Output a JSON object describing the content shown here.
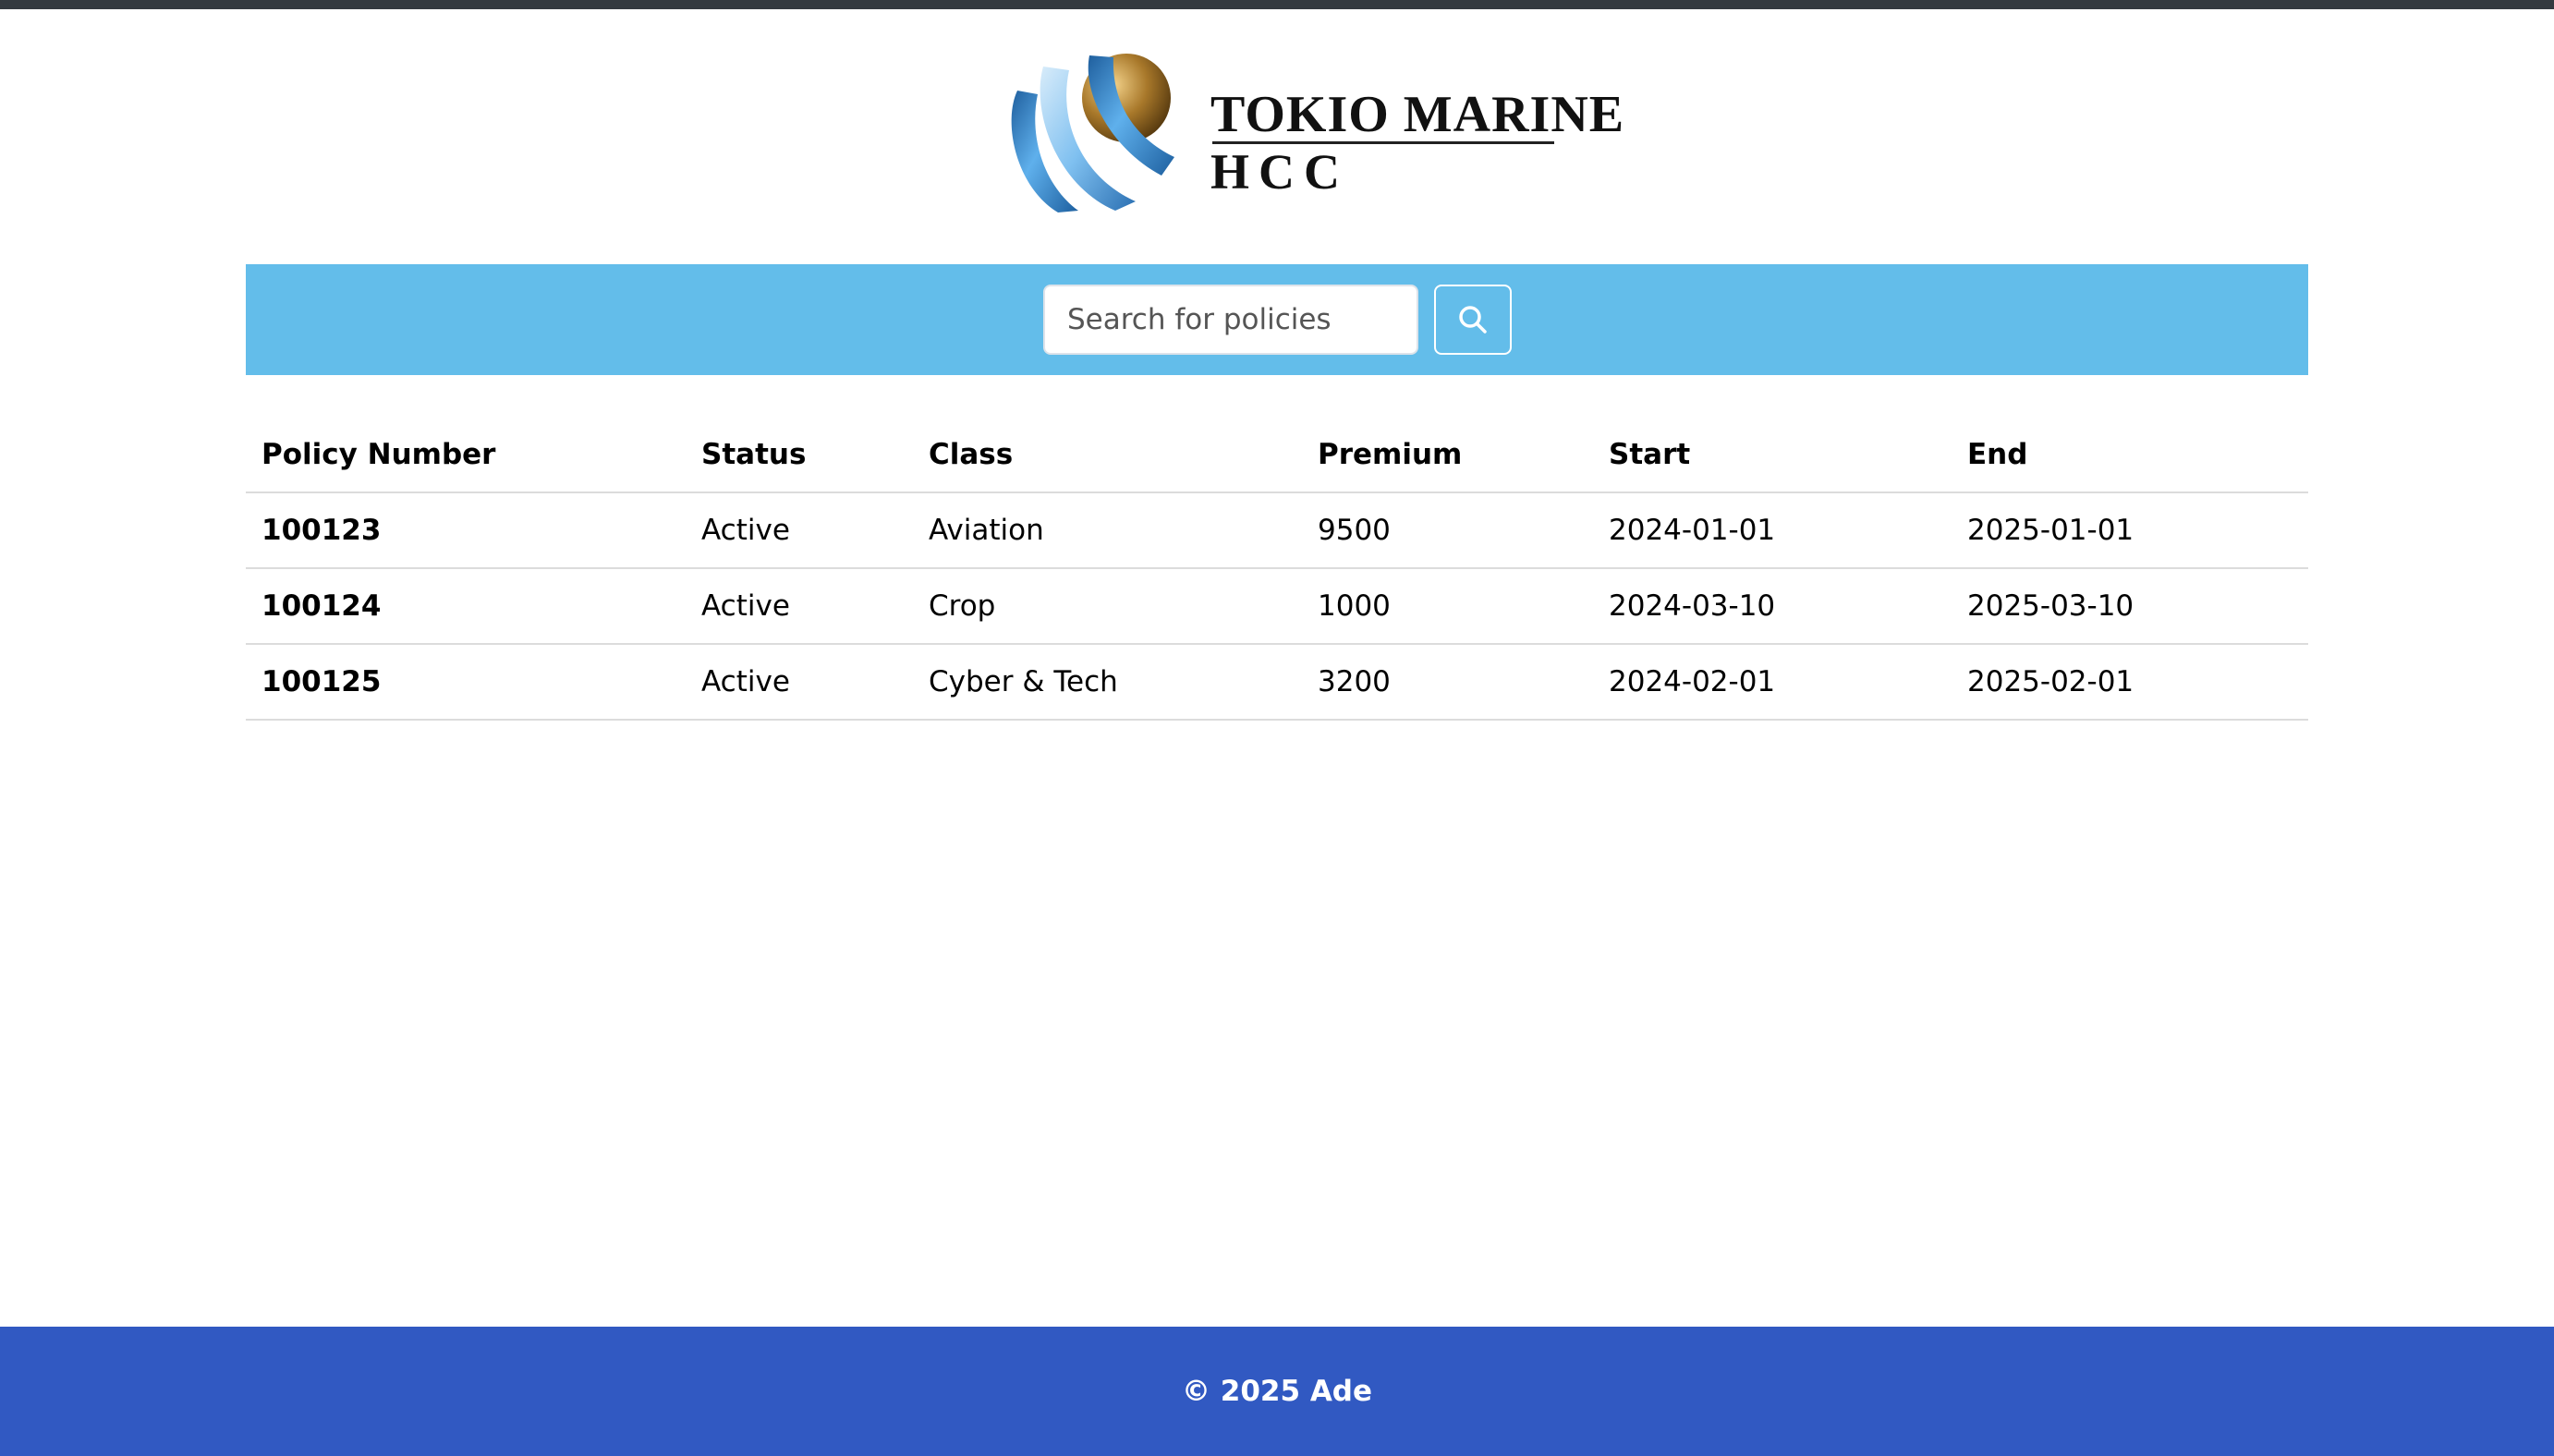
{
  "brand": {
    "logo_line1": "TOKIO MARINE",
    "logo_line2": "HCC",
    "colors": {
      "top_stripe": "#343a40",
      "search_bar": "#63bdea",
      "footer": "#3159c2",
      "logo_blue": "#3a8fd6",
      "logo_gold": "#a8782a"
    }
  },
  "search": {
    "placeholder": "Search for policies",
    "value": "",
    "button_icon": "search-icon"
  },
  "table": {
    "headers": [
      "Policy Number",
      "Status",
      "Class",
      "Premium",
      "Start",
      "End"
    ],
    "rows": [
      [
        "100123",
        "Active",
        "Aviation",
        "9500",
        "2024-01-01",
        "2025-01-01"
      ],
      [
        "100124",
        "Active",
        "Crop",
        "1000",
        "2024-03-10",
        "2025-03-10"
      ],
      [
        "100125",
        "Active",
        "Cyber & Tech",
        "3200",
        "2024-02-01",
        "2025-02-01"
      ]
    ]
  },
  "footer": {
    "text": "© 2025 Ade"
  }
}
